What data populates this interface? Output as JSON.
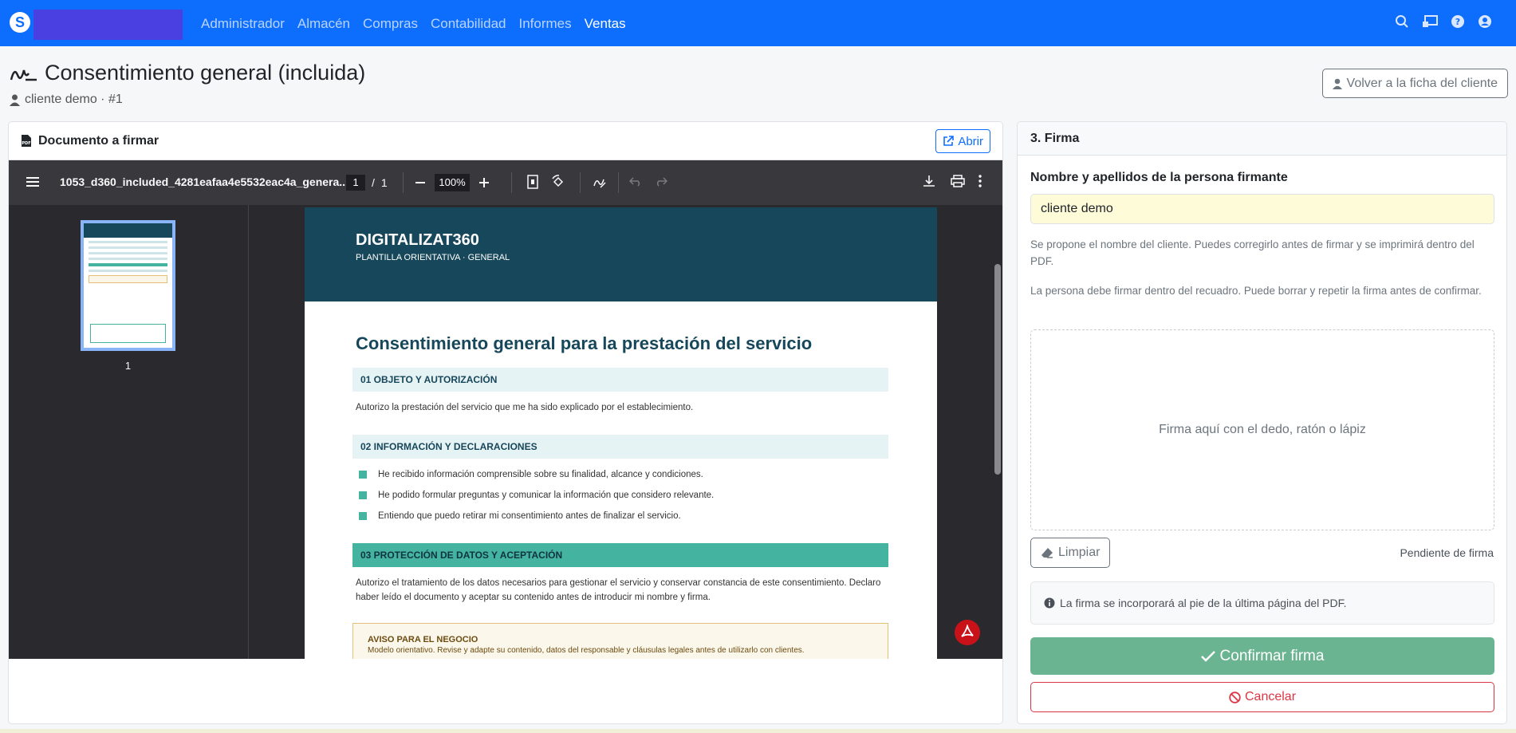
{
  "navbar": {
    "logo_glyph": "S",
    "menu": [
      {
        "label": "Administrador",
        "active": false
      },
      {
        "label": "Almacén",
        "active": false
      },
      {
        "label": "Compras",
        "active": false
      },
      {
        "label": "Contabilidad",
        "active": false
      },
      {
        "label": "Informes",
        "active": false
      },
      {
        "label": "Ventas",
        "active": true
      }
    ],
    "icons": [
      "search-icon",
      "screen-share-icon",
      "help-icon",
      "user-icon"
    ],
    "brand_color": "#0d6efd"
  },
  "header": {
    "title": "Consentimiento general (incluida)",
    "subtitle": "cliente demo · #1",
    "back_button": "Volver a la ficha del cliente"
  },
  "document_card": {
    "title": "Documento a firmar",
    "open_button": "Abrir",
    "viewer": {
      "filename": "1053_d360_included_4281eafaa4e5532eac4a_genera...",
      "current_page": "1",
      "page_separator": "/",
      "total_pages": "1",
      "zoom": "100%",
      "thumbnail_label": "1"
    },
    "pdf": {
      "brand": "DIGITALIZAT360",
      "brand_sub": "PLANTILLA ORIENTATIVA · GENERAL",
      "title": "Consentimiento general para la prestación del servicio",
      "section1": "01  OBJETO Y AUTORIZACIÓN",
      "section1_text": "Autorizo la prestación del servicio que me ha sido explicado por el establecimiento.",
      "section2": "02  INFORMACIÓN Y DECLARACIONES",
      "bullets": [
        "He recibido información comprensible sobre su finalidad, alcance y condiciones.",
        "He podido formular preguntas y comunicar la información que considero relevante.",
        "Entiendo que puedo retirar mi consentimiento antes de finalizar el servicio."
      ],
      "section3": "03  PROTECCIÓN DE DATOS Y ACEPTACIÓN",
      "section3_text": "Autorizo el tratamiento de los datos necesarios para gestionar el servicio y conservar constancia de este consentimiento. Declaro haber leído el documento y aceptar su contenido antes de introducir mi nombre y firma.",
      "warning_title": "AVISO PARA EL NEGOCIO",
      "warning_text": "Modelo orientativo. Revise y adapte su contenido, datos del responsable y cláusulas legales antes de utilizarlo con clientes."
    }
  },
  "sign_card": {
    "title": "3. Firma",
    "name_label": "Nombre y apellidos de la persona firmante",
    "name_value": "cliente demo",
    "help1": "Se propone el nombre del cliente. Puedes corregirlo antes de firmar y se imprimirá dentro del PDF.",
    "help2": "La persona debe firmar dentro del recuadro. Puede borrar y repetir la firma antes de confirmar.",
    "pad_placeholder": "Firma aquí con el dedo, ratón o lápiz",
    "clear_button": "Limpiar",
    "status": "Pendiente de firma",
    "info": "La firma se incorporará al pie de la última página del PDF.",
    "confirm_button": "Confirmar firma",
    "cancel_button": "Cancelar"
  }
}
